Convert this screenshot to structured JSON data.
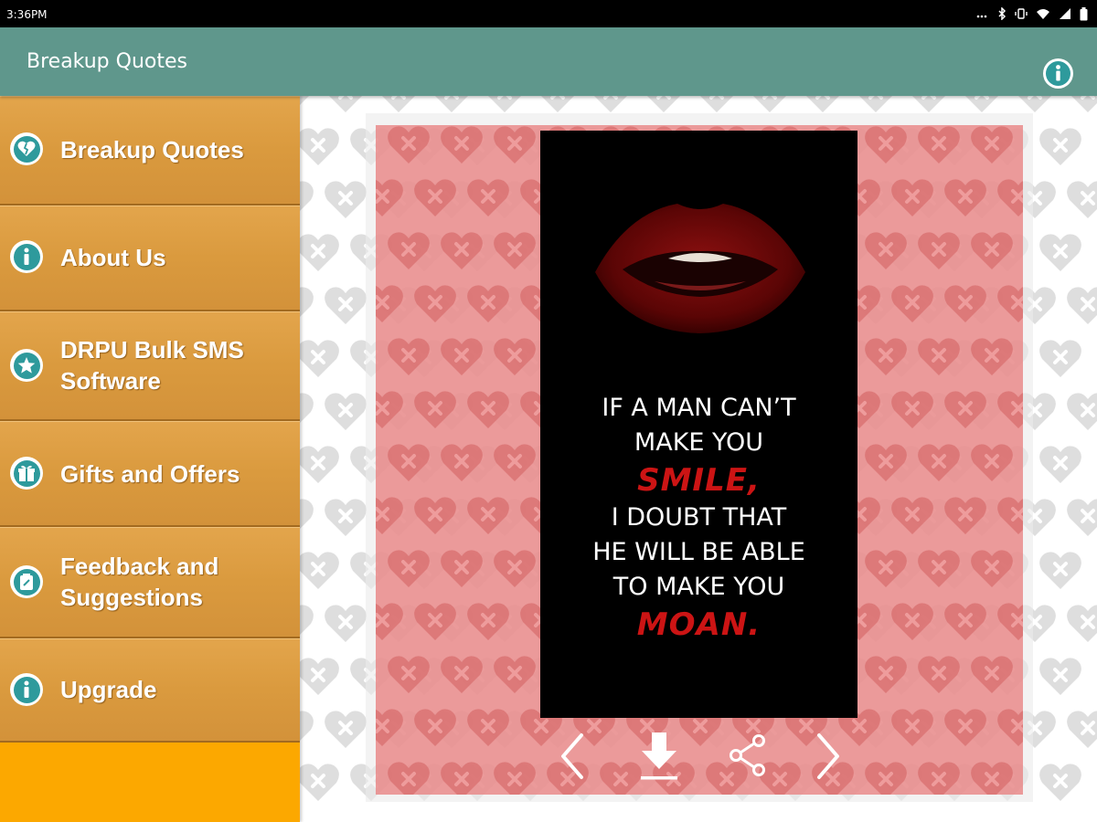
{
  "status_bar": {
    "time": "3:36PM"
  },
  "app_bar": {
    "title": "Breakup Quotes",
    "info_icon": "info-icon"
  },
  "drawer": {
    "items": [
      {
        "label": "Breakup Quotes",
        "icon": "broken-heart-icon"
      },
      {
        "label": "About Us",
        "icon": "info-icon"
      },
      {
        "label": "DRPU Bulk SMS Software",
        "label_lines": [
          "DRPU Bulk SMS",
          "Software"
        ],
        "icon": "star-icon"
      },
      {
        "label": "Gifts and Offers",
        "icon": "gift-icon"
      },
      {
        "label": "Feedback and Suggestions",
        "label_lines": [
          "Feedback and",
          "Suggestions"
        ],
        "icon": "feedback-icon"
      },
      {
        "label": "Upgrade",
        "icon": "info-icon"
      }
    ]
  },
  "quote": {
    "lines": [
      "IF A MAN CAN’T",
      "MAKE YOU",
      "SMILE,",
      "I DOUBT THAT",
      "HE WILL BE ABLE",
      "TO MAKE YOU",
      "MOAN."
    ],
    "highlight_lines": [
      2,
      6
    ]
  },
  "actions": {
    "previous": "chevron-left-icon",
    "download": "download-icon",
    "share": "share-icon",
    "next": "chevron-right-icon"
  },
  "colors": {
    "app_bar": "#5f978c",
    "drawer": "#fca800",
    "card": "#e88080",
    "icon_teal": "#2e9a9c",
    "quote_highlight": "#cc1414"
  }
}
